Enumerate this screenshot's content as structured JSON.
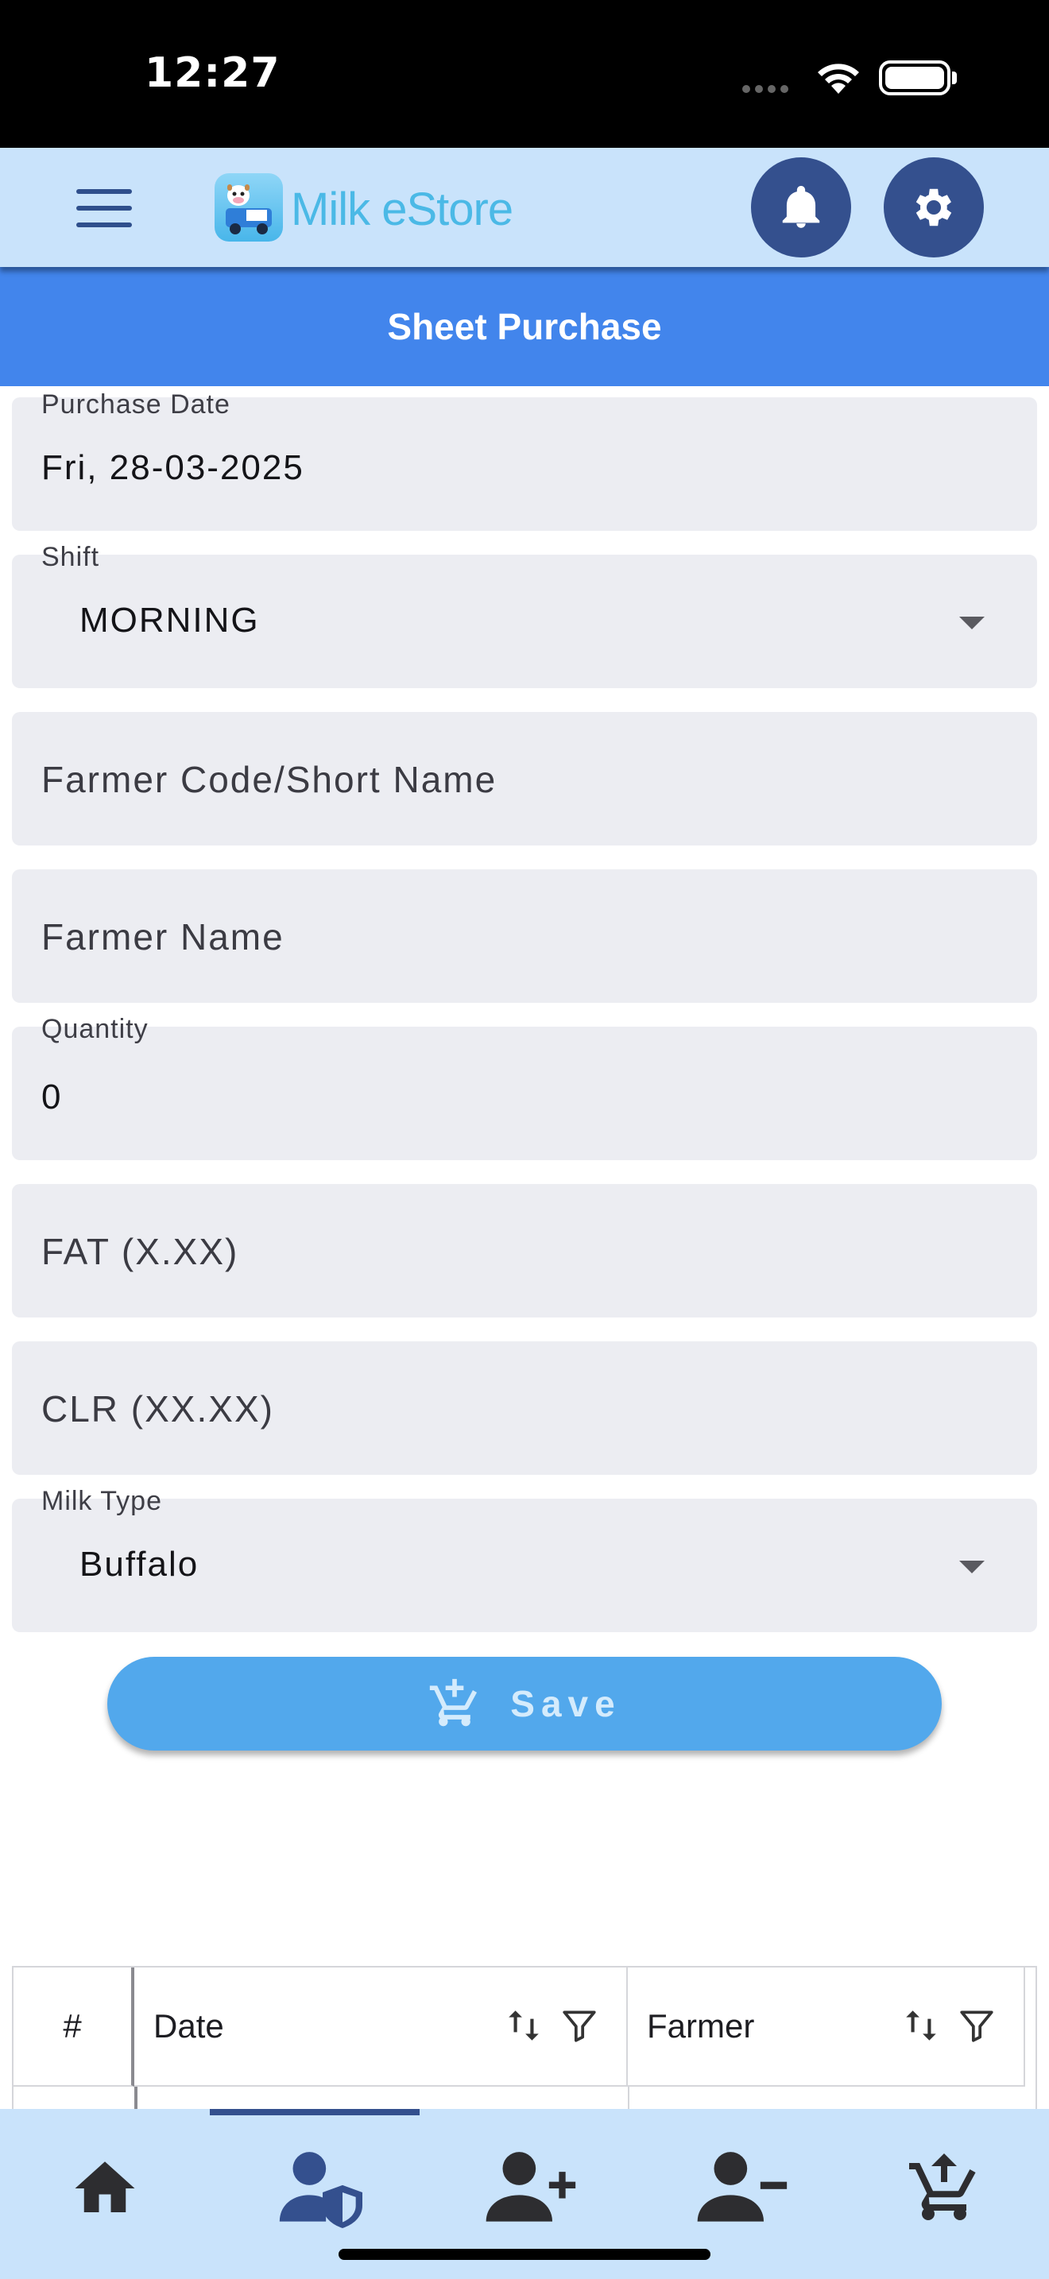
{
  "status_bar": {
    "time": "12:27"
  },
  "header": {
    "app_name": "Milk eStore",
    "menu_icon": "hamburger-menu-icon",
    "notification_icon": "bell-icon",
    "settings_icon": "gear-icon",
    "header_bg": "#c9e3fb",
    "button_color": "#34508e"
  },
  "page": {
    "title": "Sheet Purchase",
    "banner_color": "#4285ec"
  },
  "form": {
    "purchase_date": {
      "label": "Purchase Date",
      "value": "Fri, 28-03-2025"
    },
    "shift": {
      "label": "Shift",
      "value": "MORNING"
    },
    "farmer_code": {
      "placeholder": "Farmer Code/Short Name"
    },
    "farmer_name": {
      "placeholder": "Farmer Name"
    },
    "quantity": {
      "label": "Quantity",
      "value": "0"
    },
    "fat": {
      "placeholder": "FAT (X.XX)"
    },
    "clr": {
      "placeholder": "CLR (XX.XX)"
    },
    "milk_type": {
      "label": "Milk Type",
      "value": "Buffalo"
    },
    "save_label": "Save",
    "save_color": "#52a8ec"
  },
  "table": {
    "columns": [
      {
        "label": "#"
      },
      {
        "label": "Date",
        "sortable": true,
        "filterable": true
      },
      {
        "label": "Farmer",
        "sortable": true,
        "filterable": true
      }
    ]
  },
  "bottom_nav": {
    "active_index": 1,
    "items": [
      {
        "icon": "home-icon"
      },
      {
        "icon": "farmer-shield-icon"
      },
      {
        "icon": "add-user-icon"
      },
      {
        "icon": "remove-user-icon"
      },
      {
        "icon": "cart-upload-icon"
      }
    ]
  }
}
